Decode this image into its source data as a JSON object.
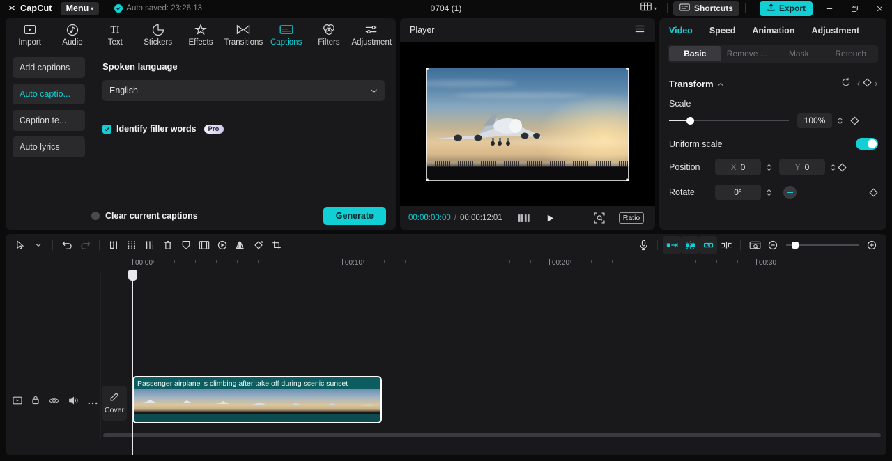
{
  "titlebar": {
    "brand": "CapCut",
    "menu_label": "Menu",
    "autosave_text": "Auto saved: 23:26:13",
    "project_title": "0704 (1)",
    "layout_icon": "layout-icon",
    "shortcuts_label": "Shortcuts",
    "shortcuts_icon": "keyboard-icon",
    "export_label": "Export",
    "export_icon": "upload-icon",
    "minimize_icon": "minimize-icon",
    "maximize_icon": "maximize-icon",
    "close_icon": "close-icon"
  },
  "function_tabs": [
    {
      "label": "Import",
      "icon": "import-icon",
      "active": false
    },
    {
      "label": "Audio",
      "icon": "audio-icon",
      "active": false
    },
    {
      "label": "Text",
      "icon": "text-icon",
      "active": false
    },
    {
      "label": "Stickers",
      "icon": "stickers-icon",
      "active": false
    },
    {
      "label": "Effects",
      "icon": "effects-icon",
      "active": false
    },
    {
      "label": "Transitions",
      "icon": "transitions-icon",
      "active": false
    },
    {
      "label": "Captions",
      "icon": "captions-icon",
      "active": true
    },
    {
      "label": "Filters",
      "icon": "filters-icon",
      "active": false
    },
    {
      "label": "Adjustment",
      "icon": "adjustment-icon",
      "active": false
    }
  ],
  "captions_panel": {
    "sub_nav": [
      {
        "label": "Add captions",
        "active": false
      },
      {
        "label": "Auto captio...",
        "active": true
      },
      {
        "label": "Caption te...",
        "active": false
      },
      {
        "label": "Auto lyrics",
        "active": false
      }
    ],
    "spoken_language_label": "Spoken language",
    "language_value": "English",
    "filler_words_label": "Identify filler words",
    "filler_words_checked": true,
    "pro_badge": "Pro",
    "clear_captions_label": "Clear current captions",
    "clear_captions_checked": false,
    "generate_label": "Generate"
  },
  "player": {
    "title": "Player",
    "menu_icon": "hamburger-icon",
    "current_time": "00:00:00:00",
    "time_separator": "/",
    "total_time": "00:00:12:01",
    "frames_icon": "frames-icon",
    "play_icon": "play-icon",
    "zoom_fit_icon": "zoom-fit-icon",
    "ratio_label": "Ratio",
    "fullscreen_icon": "fullscreen-icon",
    "preview_description": "Passenger airplane climbing after take off during scenic sunset"
  },
  "attributes": {
    "tabs": [
      {
        "label": "Video",
        "active": true
      },
      {
        "label": "Speed",
        "active": false
      },
      {
        "label": "Animation",
        "active": false
      },
      {
        "label": "Adjustment",
        "active": false
      }
    ],
    "segments": [
      {
        "label": "Basic",
        "active": true,
        "enabled": true
      },
      {
        "label": "Remove ...",
        "active": false,
        "enabled": false
      },
      {
        "label": "Mask",
        "active": false,
        "enabled": false
      },
      {
        "label": "Retouch",
        "active": false,
        "enabled": false
      }
    ],
    "transform": {
      "title": "Transform",
      "collapse_icon": "chevron-up-icon",
      "reset_icon": "reset-icon",
      "keyframe_icon": "keyframe-diamond-icon",
      "scale_label": "Scale",
      "scale_value": "100%",
      "scale_percent": 17,
      "uniform_scale_label": "Uniform scale",
      "uniform_scale_on": true,
      "position_label": "Position",
      "position_x_label": "X",
      "position_x_value": "0",
      "position_y_label": "Y",
      "position_y_value": "0",
      "rotate_label": "Rotate",
      "rotate_value": "0°"
    }
  },
  "timeline": {
    "toolbar_left": [
      {
        "icon": "select-arrow-icon",
        "enabled": true
      },
      {
        "icon": "chevron-down-icon",
        "enabled": true
      },
      {
        "icon": "undo-icon",
        "enabled": true
      },
      {
        "icon": "redo-icon",
        "enabled": false
      },
      {
        "icon": "split-icon",
        "enabled": true
      },
      {
        "icon": "trim-left-icon",
        "enabled": true
      },
      {
        "icon": "trim-right-icon",
        "enabled": true
      },
      {
        "icon": "delete-icon",
        "enabled": true
      },
      {
        "icon": "freeze-icon",
        "enabled": true
      },
      {
        "icon": "crop-frame-icon",
        "enabled": true
      },
      {
        "icon": "reverse-icon",
        "enabled": true
      },
      {
        "icon": "mirror-icon",
        "enabled": true
      },
      {
        "icon": "rotate-icon",
        "enabled": true
      },
      {
        "icon": "crop-icon",
        "enabled": true
      }
    ],
    "toolbar_right": [
      {
        "icon": "microphone-icon",
        "highlighted": false
      },
      {
        "icon": "snap-left-icon",
        "highlighted": true
      },
      {
        "icon": "magnet-snap-icon",
        "highlighted": true
      },
      {
        "icon": "snap-right-icon",
        "highlighted": true
      },
      {
        "icon": "link-cut-icon",
        "highlighted": false
      },
      {
        "icon": "preview-render-icon",
        "highlighted": false
      },
      {
        "icon": "zoom-out-icon",
        "highlighted": false
      },
      {
        "icon": "zoom-in-icon",
        "highlighted": false
      }
    ],
    "ruler_labels": [
      "00:00",
      "00:10",
      "00:20",
      "00:30"
    ],
    "track_head_icons": [
      "video-track-icon",
      "lock-icon",
      "eye-icon",
      "volume-icon",
      "more-icon"
    ],
    "cover_label": "Cover",
    "cover_icon": "pencil-icon",
    "clip": {
      "caption": "Passenger airplane is climbing after take off during scenic sunset",
      "thumbnail_count": 7
    }
  }
}
